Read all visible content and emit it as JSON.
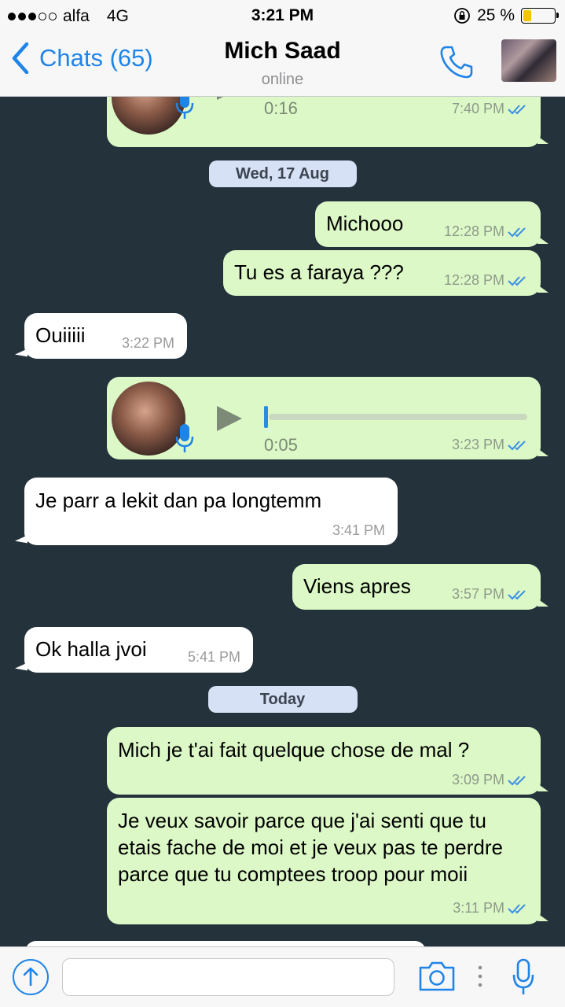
{
  "status_bar": {
    "carrier": "alfa",
    "network": "4G",
    "time": "3:21 PM",
    "battery_percent": "25 %",
    "battery_level": 0.25,
    "signal_bars_filled": 3,
    "signal_bars_total": 5
  },
  "header": {
    "back_label": "Chats (65)",
    "contact_name": "Mich Saad",
    "status": "online",
    "icons": [
      "chevron-left-icon",
      "phone-icon",
      "contact-avatar"
    ]
  },
  "colors": {
    "accent": "#1f84e8",
    "outgoing_bubble": "#dcf8c6",
    "incoming_bubble": "#ffffff",
    "chat_background": "#24323c",
    "date_pill": "#d7e1f5"
  },
  "messages": [
    {
      "type": "voice",
      "dir": "out",
      "duration": "0:16",
      "time": "7:40 PM",
      "read": true
    },
    {
      "type": "date",
      "label": "Wed, 17 Aug"
    },
    {
      "type": "text",
      "dir": "out",
      "text": "Michooo",
      "time": "12:28 PM",
      "read": true
    },
    {
      "type": "text",
      "dir": "out",
      "text": "Tu es a faraya ???",
      "time": "12:28 PM",
      "read": true
    },
    {
      "type": "text",
      "dir": "in",
      "text": "Ouiiiii",
      "time": "3:22 PM"
    },
    {
      "type": "voice",
      "dir": "out",
      "duration": "0:05",
      "time": "3:23 PM",
      "read": true
    },
    {
      "type": "text",
      "dir": "in",
      "text": "Je parr a lekit dan pa longtemm",
      "time": "3:41 PM"
    },
    {
      "type": "text",
      "dir": "out",
      "text": "Viens apres",
      "time": "3:57 PM",
      "read": true
    },
    {
      "type": "text",
      "dir": "in",
      "text": "Ok halla jvoi",
      "time": "5:41 PM"
    },
    {
      "type": "date",
      "label": "Today"
    },
    {
      "type": "text",
      "dir": "out",
      "text": "Mich je t'ai fait quelque chose de mal ?",
      "time": "3:09 PM",
      "read": true
    },
    {
      "type": "text",
      "dir": "out",
      "text": "Je veux savoir parce que j'ai senti que tu etais fache de moi et je veux pas te perdre parce que tu comptees troop pour moii",
      "time": "3:11 PM",
      "read": true
    }
  ],
  "input_bar": {
    "placeholder": "",
    "icons": [
      "upload-icon",
      "camera-icon",
      "more-icon",
      "microphone-icon"
    ]
  }
}
